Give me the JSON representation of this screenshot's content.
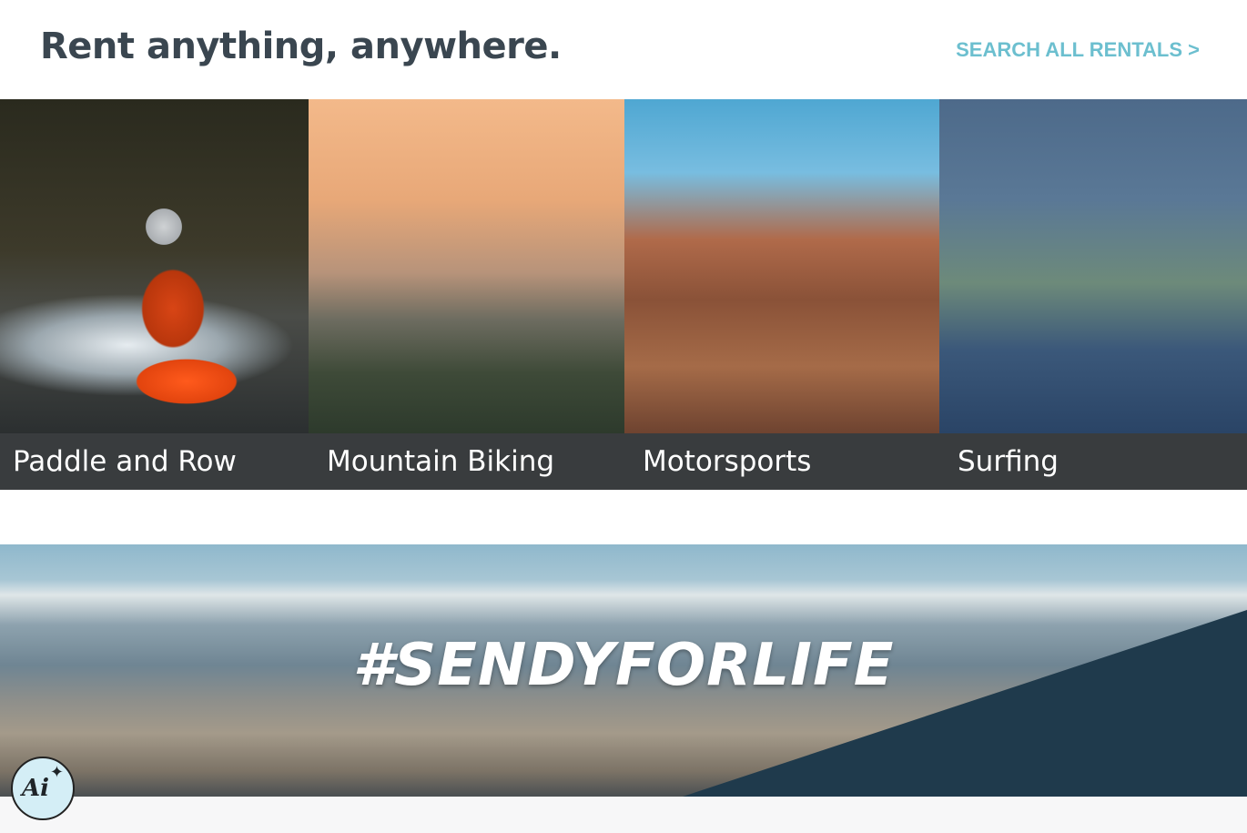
{
  "header": {
    "title": "Rent anything, anywhere.",
    "search_link": "SEARCH ALL RENTALS >"
  },
  "categories": [
    {
      "label": "Paddle and Row"
    },
    {
      "label": "Mountain Biking"
    },
    {
      "label": "Motorsports"
    },
    {
      "label": "Surfing"
    }
  ],
  "banner": {
    "hashtag": "#SENDYFORLIFE"
  },
  "ai_button": {
    "label": "Ai",
    "icon": "sparkle-icon"
  },
  "colors": {
    "title": "#3a4650",
    "link": "#6cbfcf",
    "caption_bg": "#282b2e"
  }
}
